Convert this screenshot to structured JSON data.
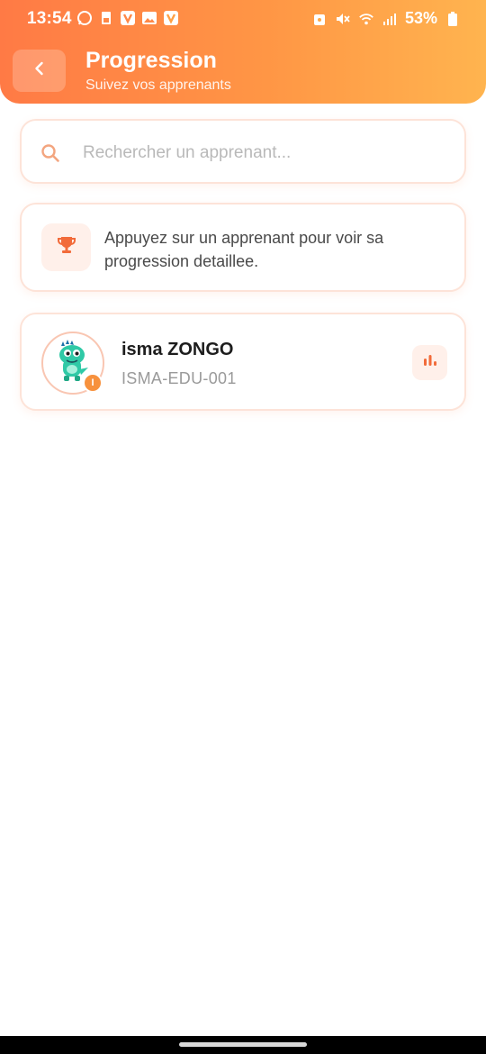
{
  "status_bar": {
    "time": "13:54",
    "battery": "53%",
    "left_icons": [
      "whatsapp-icon",
      "sim-icon",
      "v-app-icon",
      "gallery-icon",
      "v-app-icon"
    ],
    "right_icons": [
      "alarm-icon",
      "mute-icon",
      "wifi-icon",
      "signal-icon",
      "battery-icon"
    ]
  },
  "header": {
    "title": "Progression",
    "subtitle": "Suivez vos apprenants",
    "back_icon": "chevron-left-icon",
    "gradient": [
      "#ff7a45",
      "#ffb44f"
    ]
  },
  "search": {
    "placeholder": "Rechercher un apprenant...",
    "value": "",
    "icon": "search-icon"
  },
  "info_card": {
    "icon": "trophy-icon",
    "text": "Appuyez sur un apprenant pour voir sa progression detaillee."
  },
  "learners": [
    {
      "name": "isma ZONGO",
      "code": "ISMA-EDU-001",
      "avatar": "dino-avatar",
      "badge": "I",
      "action_icon": "bar-chart-icon"
    }
  ],
  "colors": {
    "accent": "#ff7a45",
    "badge": "#f7913d",
    "card_border": "#fde3d8",
    "icon_bg": "#fff0ea"
  }
}
